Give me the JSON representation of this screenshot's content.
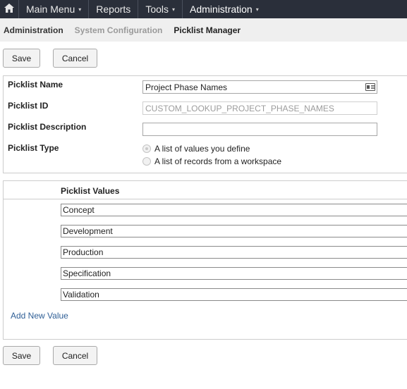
{
  "nav": {
    "home_icon": "home-icon",
    "items": [
      {
        "label": "Main Menu",
        "has_caret": true
      },
      {
        "label": "Reports",
        "has_caret": false
      },
      {
        "label": "Tools",
        "has_caret": true
      },
      {
        "label": "Administration",
        "has_caret": true
      }
    ],
    "caret": "▾"
  },
  "breadcrumb": {
    "items": [
      "Administration",
      "System Configuration",
      "Picklist Manager"
    ]
  },
  "actions": {
    "save_label": "Save",
    "cancel_label": "Cancel"
  },
  "form": {
    "name_label": "Picklist Name",
    "name_value": "Project Phase Names",
    "id_label": "Picklist ID",
    "id_value": "CUSTOM_LOOKUP_PROJECT_PHASE_NAMES",
    "description_label": "Picklist Description",
    "description_value": "",
    "type_label": "Picklist Type",
    "type_options": [
      {
        "label": "A list of values you define",
        "checked": true
      },
      {
        "label": "A list of records from a workspace",
        "checked": false
      }
    ]
  },
  "values": {
    "header": "Picklist Values",
    "items": [
      "Concept",
      "Development",
      "Production",
      "Specification",
      "Validation"
    ],
    "add_label": "Add New Value"
  },
  "colors": {
    "nav_bg": "#2a2f3a",
    "breadcrumb_bg": "#efefef",
    "link": "#2f5f96"
  }
}
